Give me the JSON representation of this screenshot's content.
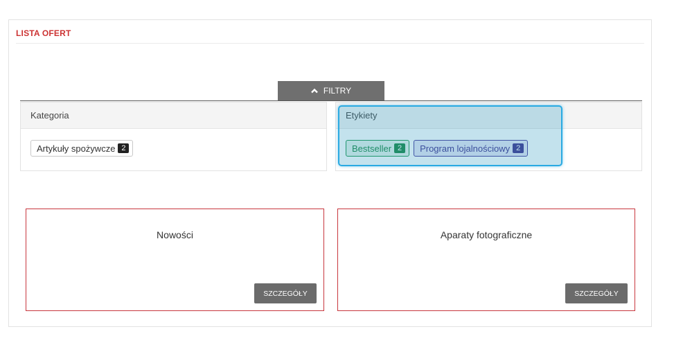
{
  "panel": {
    "title": "LISTA OFERT"
  },
  "filters": {
    "toggle_label": "FILTRY",
    "category": {
      "header": "Kategoria",
      "tags": [
        {
          "label": "Artykuły spożywcze",
          "count": "2"
        }
      ]
    },
    "labels": {
      "header": "Etykiety",
      "tags": [
        {
          "label": "Bestseller",
          "count": "2",
          "color": "#1e8a48"
        },
        {
          "label": "Program lojalnościowy",
          "count": "2",
          "color": "#43348f"
        }
      ]
    }
  },
  "offers": [
    {
      "title": "Nowości",
      "button_label": "SZCZEGÓŁY"
    },
    {
      "title": "Aparaty fotograficzne",
      "button_label": "SZCZEGÓŁY"
    }
  ],
  "colors": {
    "accent_red": "#cc3333",
    "offer_border": "#c8363d",
    "button_gray": "#6b6b6b",
    "highlight": "#29aae2"
  }
}
